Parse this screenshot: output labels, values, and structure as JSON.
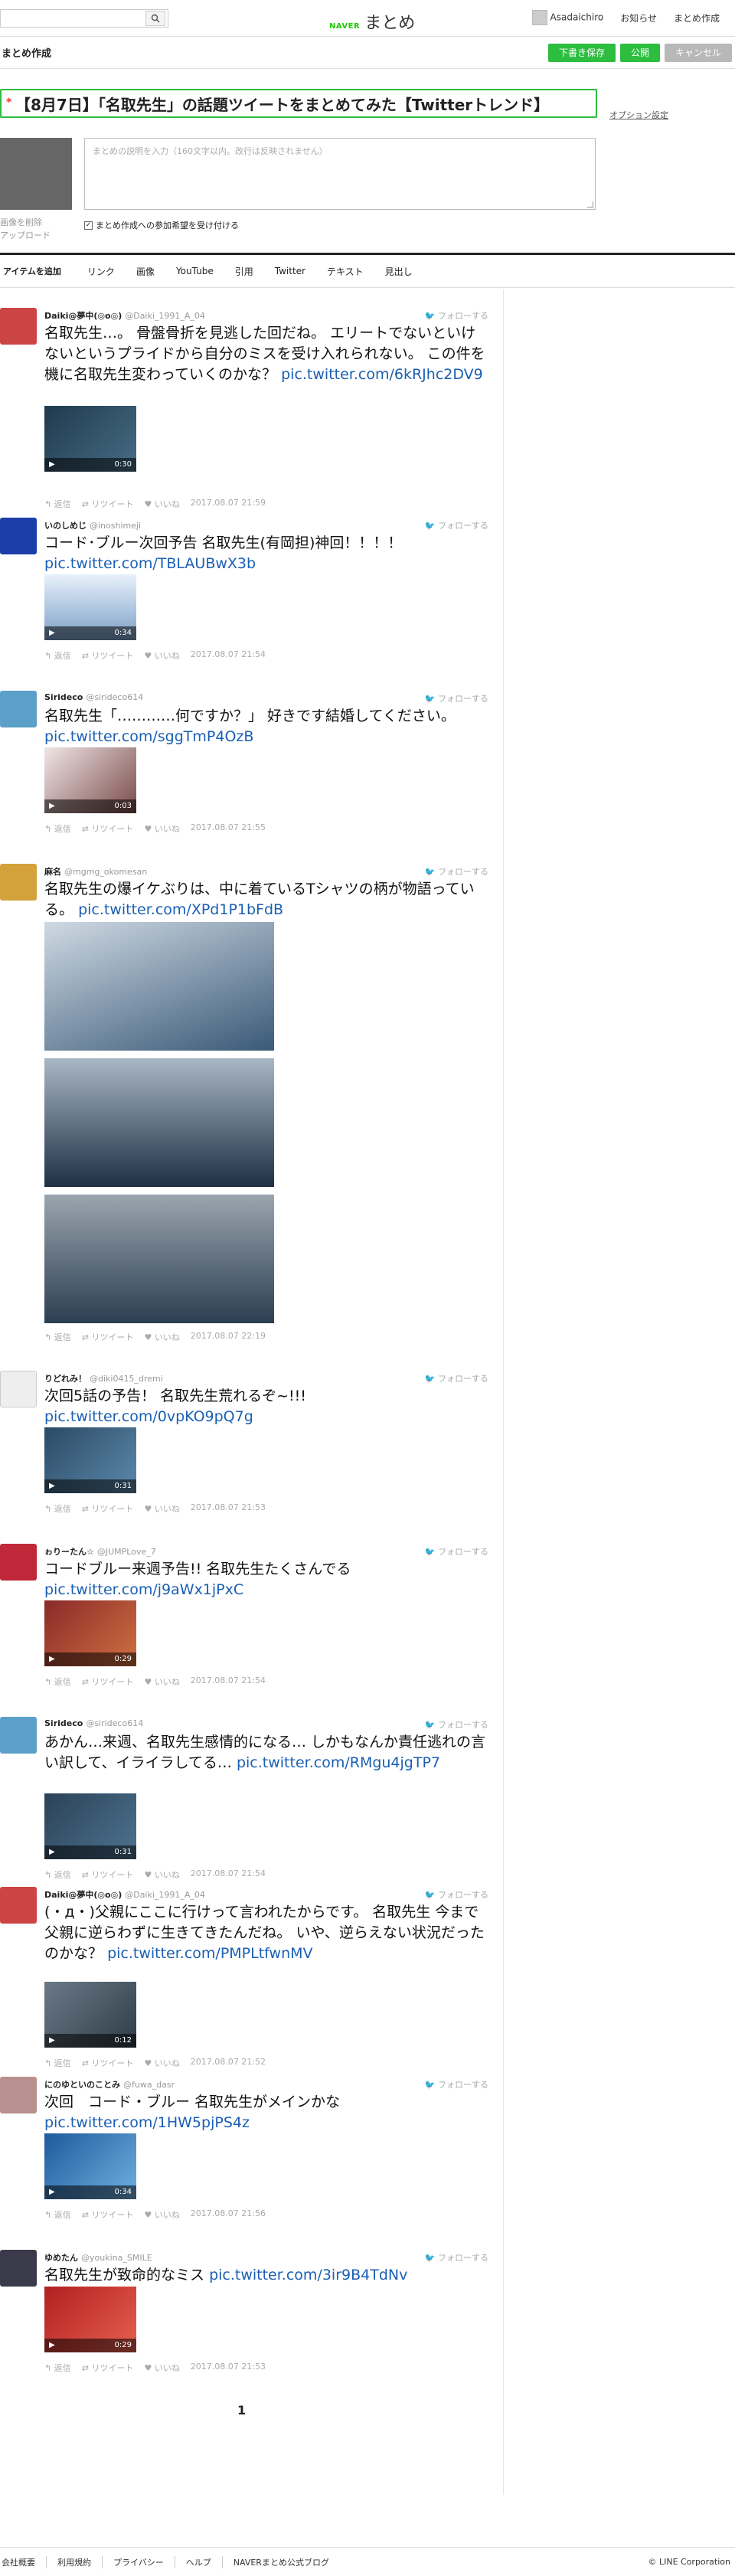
{
  "header": {
    "logo_naver": "NAVER",
    "logo_matome": "まとめ",
    "user_name": "Asadaichiro",
    "notifications": "お知らせ",
    "create": "まとめ作成"
  },
  "editor": {
    "section_title": "まとめ作成",
    "save_draft": "下書き保存",
    "publish": "公開",
    "cancel": "キャンセル",
    "required_mark": "*",
    "title_value": "【8月7日】「名取先生」の話題ツイートをまとめてみた【Twitterトレンド】",
    "option_settings": "オプション設定",
    "desc_placeholder": "まとめの説明を入力（160文字以内。改行は反映されません）",
    "image_delete": "画像を削除",
    "image_upload": "アップロード",
    "participate_label": "まとめ作成への参加希望を受け付ける",
    "participate_checked": true
  },
  "toolbar": {
    "lead": "アイテムを追加",
    "items": [
      "リンク",
      "画像",
      "YouTube",
      "引用",
      "Twitter",
      "テキスト",
      "見出し"
    ]
  },
  "tweets": [
    {
      "name": "Daiki@夢中(◎o◎)",
      "screen": "@Daiki_1991_A_04",
      "text": "名取先生…。 骨盤骨折を見逃した回だね。 エリートでないといけないというプライドから自分のミスを受け入れられない。 この件を機に名取先生変わっていくのかな？",
      "link": "pic.twitter.com/6kRJhc2DV9",
      "duration": "0:30",
      "time": "2017.08.07 21:59"
    },
    {
      "name": "いのしめじ",
      "screen": "@inoshimeji",
      "text": "コード･ブルー次回予告 名取先生(有岡担)神回！！！！",
      "link": "pic.twitter.com/TBLAUBwX3b",
      "duration": "0:34",
      "time": "2017.08.07 21:54"
    },
    {
      "name": "Sirideco",
      "screen": "@sirideco614",
      "text": "名取先生「…………何ですか？」 好きです結婚してください。",
      "link": "pic.twitter.com/sggTmP4OzB",
      "duration": "0:03",
      "time": "2017.08.07 21:55"
    },
    {
      "name": "麻名",
      "screen": "@mgmg_okomesan",
      "text": "名取先生の爆イケぶりは、中に着ているTシャツの柄が物語っている。",
      "link": "pic.twitter.com/XPd1P1bFdB",
      "duration": "",
      "time": "2017.08.07 22:19"
    },
    {
      "name": "りどれみ！",
      "screen": "@diki0415_dremi",
      "text": "次回5話の予告！ 名取先生荒れるぞ~!!!",
      "link": "pic.twitter.com/0vpKO9pQ7g",
      "duration": "0:31",
      "time": "2017.08.07 21:53"
    },
    {
      "name": "ゎりーたん☆",
      "screen": "@JUMPLove_7",
      "text": "コードブルー来週予告!! 名取先生たくさんでる",
      "link": "pic.twitter.com/j9aWx1jPxC",
      "duration": "0:29",
      "time": "2017.08.07 21:54"
    },
    {
      "name": "Sirideco",
      "screen": "@sirideco614",
      "text": "あかん…来週、名取先生感情的になる… しかもなんか責任逃れの言い訳して、イライラしてる…",
      "link": "pic.twitter.com/RMgu4jgTP7",
      "duration": "0:31",
      "time": "2017.08.07 21:54"
    },
    {
      "name": "Daiki@夢中(◎o◎)",
      "screen": "@Daiki_1991_A_04",
      "text": "(・д・)父親にここに行けって言われたからです。 名取先生 今まで父親に逆らわずに生きてきたんだね。 いや、逆らえない状況だったのかな？",
      "link": "pic.twitter.com/PMPLtfwnMV",
      "duration": "0:12",
      "time": "2017.08.07 21:52"
    },
    {
      "name": "にのゆといのことみ",
      "screen": "@fuwa_dasr",
      "text": "次回　コード・ブルー 名取先生がメインかな",
      "link": "pic.twitter.com/1HW5pjPS4z",
      "duration": "0:34",
      "time": "2017.08.07 21:56"
    },
    {
      "name": "ゆめたん",
      "screen": "@youkina_SMILE",
      "text": "名取先生が致命的なミス",
      "link": "pic.twitter.com/3ir9B4TdNv",
      "duration": "0:29",
      "time": "2017.08.07 21:53"
    }
  ],
  "tweet_actions": {
    "follow": "フォローする",
    "reply": "返信",
    "retweet": "リツイート",
    "like": "いいね"
  },
  "pager": {
    "current": "1"
  },
  "footer": {
    "links": [
      "会社概要",
      "利用規約",
      "プライバシー",
      "ヘルプ",
      "NAVERまとめ公式ブログ"
    ],
    "copyright": "© LINE Corporation"
  },
  "colors": {
    "accent": "#2dbd3f",
    "link": "#1a5fb4",
    "cancel": "#b8b8b8"
  }
}
